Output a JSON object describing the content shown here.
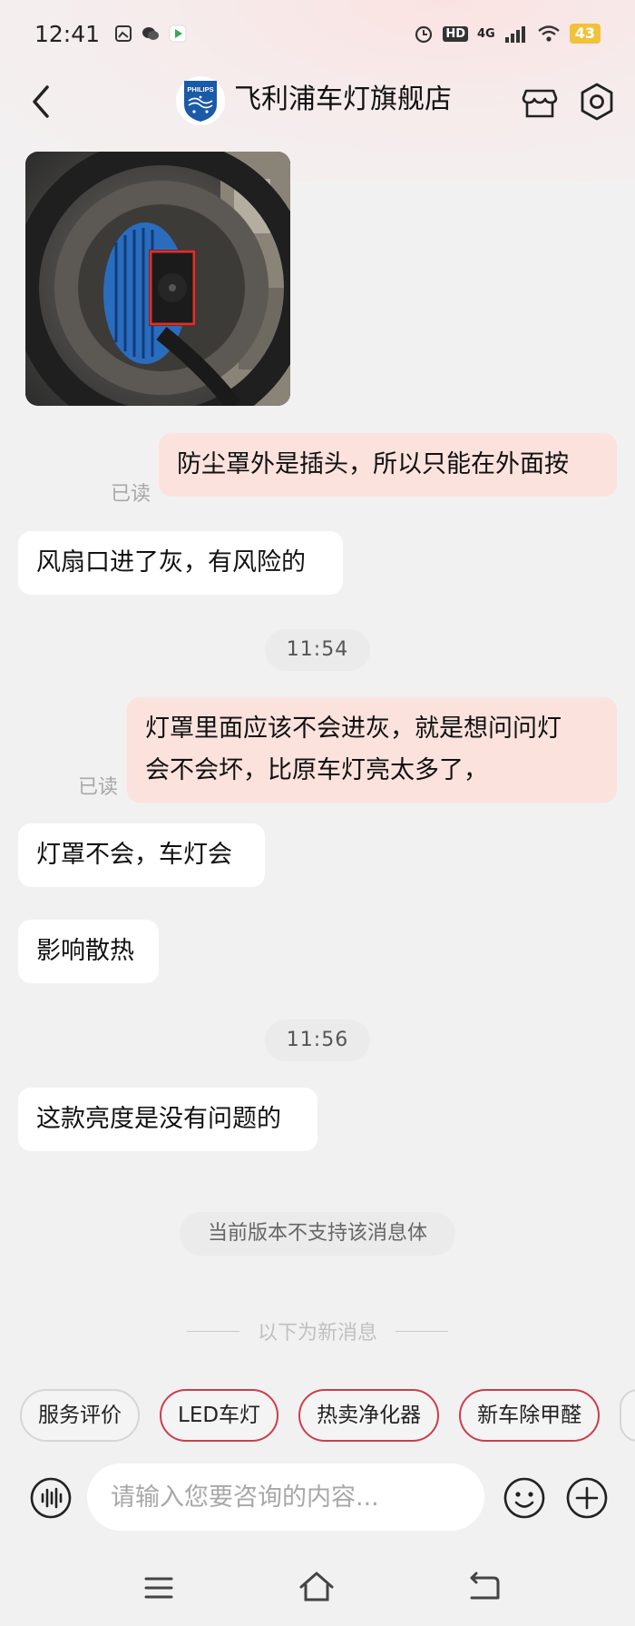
{
  "status_bar": {
    "time": "12:41",
    "network": "4G",
    "hd_label": "HD",
    "battery": "43"
  },
  "header": {
    "store_name": "飞利浦车灯旗舰店",
    "logo_text": "PHILIPS"
  },
  "messages": [
    {
      "id": "m1",
      "side": "out",
      "text": "防尘罩外是插头，所以只能在外面按",
      "read_label": "已读"
    },
    {
      "id": "m2",
      "side": "in",
      "text": "风扇口进了灰，有风险的"
    },
    {
      "id": "t1",
      "time": "11:54"
    },
    {
      "id": "m3",
      "side": "out",
      "lines": [
        "灯罩里面应该不会进灰，就是想问问灯",
        "会不会坏，比原车灯亮太多了，"
      ],
      "read_label": "已读"
    },
    {
      "id": "m4",
      "side": "in",
      "text": "灯罩不会，车灯会"
    },
    {
      "id": "m5",
      "side": "in",
      "text": "影响散热"
    },
    {
      "id": "t2",
      "time": "11:56"
    },
    {
      "id": "m6",
      "side": "in",
      "text": "这款亮度是没有问题的"
    }
  ],
  "system_notice": "当前版本不支持该消息体",
  "new_messages_divider": "以下为新消息",
  "quick_replies": [
    {
      "label": "服务评价",
      "style": "grey"
    },
    {
      "label": "LED车灯",
      "style": "red"
    },
    {
      "label": "热卖净化器",
      "style": "red"
    },
    {
      "label": "新车除甲醛",
      "style": "red"
    }
  ],
  "input": {
    "placeholder": "请输入您要咨询的内容..."
  },
  "colors": {
    "outgoing_bubble": "#fbe2dd",
    "incoming_bubble": "#ffffff",
    "chip_accent": "#cc3d4c",
    "battery": "#f0c23a",
    "logo_blue": "#1a5aa8"
  },
  "icons": {
    "back": "chevron-left-icon",
    "shop": "store-icon",
    "settings": "settings-icon",
    "voice": "voice-icon",
    "emoji": "emoji-icon",
    "plus": "plus-icon",
    "nav_menu": "menu-icon",
    "nav_home": "home-icon",
    "nav_back": "back-icon"
  }
}
